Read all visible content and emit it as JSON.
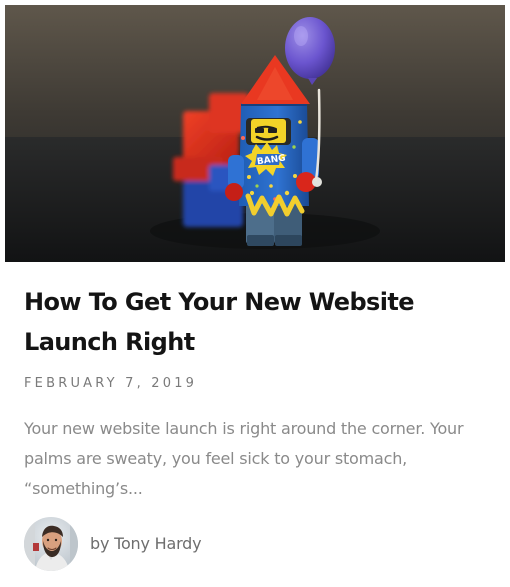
{
  "post": {
    "title": "How To Get Your New Website Launch Right",
    "date": "February 7, 2019",
    "excerpt": "Your new website launch is right around the corner. Your palms are sweaty, you feel sick to your stomach, “something’s...",
    "author": "by Tony Hardy",
    "image_icon": "lego-rocket-minifigure-image",
    "avatar_icon": "author-avatar"
  },
  "colors": {
    "title": "#141414",
    "meta": "#7a7a7a",
    "excerpt": "#8a8a8a",
    "background": "#ffffff"
  }
}
